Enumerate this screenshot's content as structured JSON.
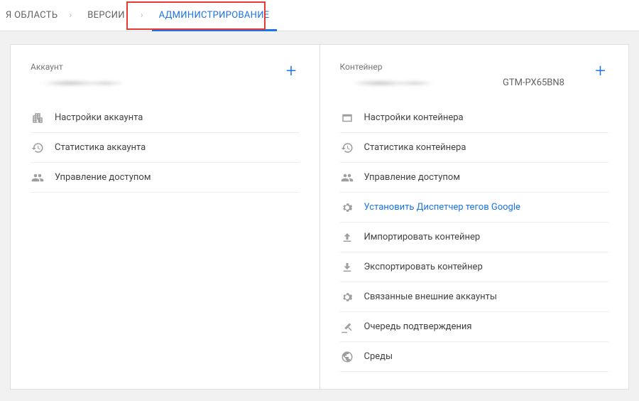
{
  "tabs": {
    "partial": "Я ОБЛАСТЬ",
    "versions": "ВЕРСИИ",
    "admin": "АДМИНИСТРИРОВАНИЕ"
  },
  "account": {
    "header": "Аккаунт",
    "items": [
      {
        "label": "Настройки аккаунта"
      },
      {
        "label": "Статистика аккаунта"
      },
      {
        "label": "Управление доступом"
      }
    ]
  },
  "container": {
    "header": "Контейнер",
    "id": "GTM-PX65BN8",
    "items": [
      {
        "label": "Настройки контейнера"
      },
      {
        "label": "Статистика контейнера"
      },
      {
        "label": "Управление доступом"
      },
      {
        "label": "Установить Диспетчер тегов Google"
      },
      {
        "label": "Импортировать контейнер"
      },
      {
        "label": "Экспортировать контейнер"
      },
      {
        "label": "Связанные внешние аккаунты"
      },
      {
        "label": "Очередь подтверждения"
      },
      {
        "label": "Среды"
      }
    ]
  }
}
